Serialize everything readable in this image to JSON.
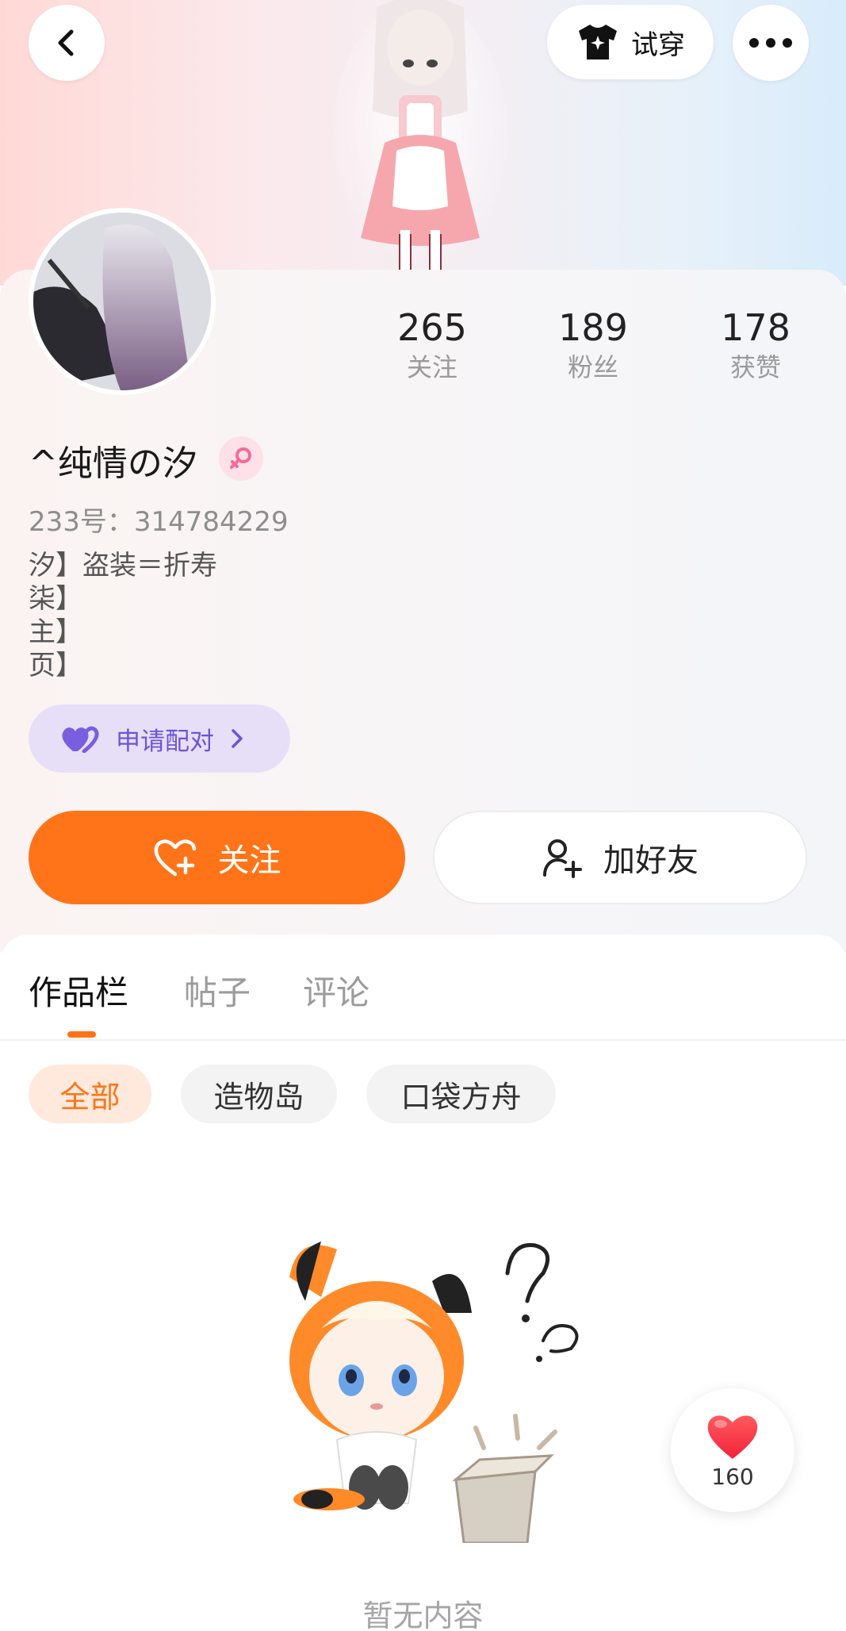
{
  "header": {
    "tryon_label": "试穿",
    "icons": {
      "back": "back-arrow-icon",
      "tryon": "tshirt-icon",
      "more": "more-icon"
    }
  },
  "profile": {
    "stats": [
      {
        "value": "265",
        "label": "关注"
      },
      {
        "value": "189",
        "label": "粉丝"
      },
      {
        "value": "178",
        "label": "获赞"
      }
    ],
    "nickname": "^纯情の汐",
    "uid": "233号：314784229",
    "bio_lines": [
      "汐】盗装＝折寿",
      "柒】",
      "主】",
      "页】"
    ],
    "pair_label": "申请配对",
    "follow_label": "关注",
    "add_friend_label": "加好友"
  },
  "tabs": [
    {
      "label": "作品栏",
      "active": true
    },
    {
      "label": "帖子",
      "active": false
    },
    {
      "label": "评论",
      "active": false
    }
  ],
  "filters": [
    {
      "label": "全部",
      "active": true
    },
    {
      "label": "造物岛",
      "active": false
    },
    {
      "label": "口袋方舟",
      "active": false
    }
  ],
  "empty_state": {
    "text": "暂无内容"
  },
  "like_float": {
    "count": "160"
  },
  "colors": {
    "accent": "#ff7418",
    "pair_purple": "#6a55d9",
    "gender_pink": "#f26a97"
  }
}
